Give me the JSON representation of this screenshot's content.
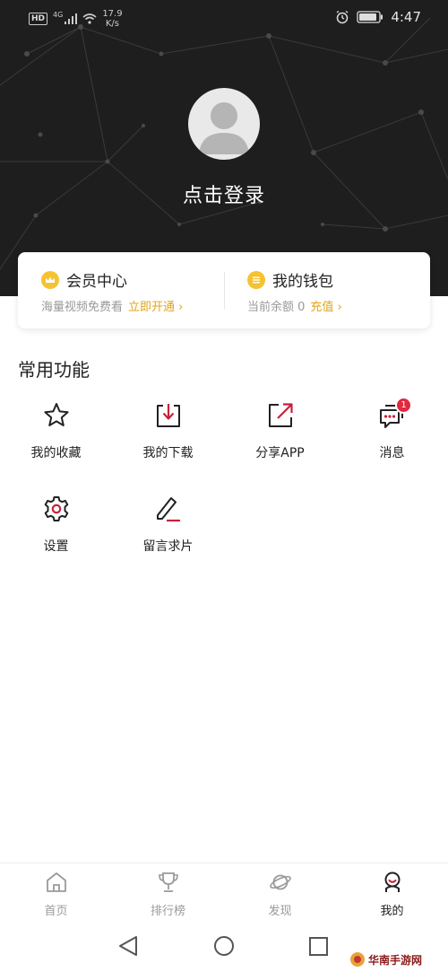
{
  "status_bar": {
    "hd": "HD",
    "signal_type": "4G",
    "net_speed_value": "17.9",
    "net_speed_unit": "K/s",
    "time": "4:47",
    "icons": [
      "signal-icon",
      "wifi-icon",
      "alarm-icon",
      "battery-icon"
    ]
  },
  "profile": {
    "login_text": "点击登录"
  },
  "membership": {
    "title": "会员中心",
    "subtitle": "海量视频免费看",
    "action": "立即开通 ›"
  },
  "wallet": {
    "title": "我的钱包",
    "subtitle": "当前余额 0",
    "action": "充值 ›"
  },
  "functions": {
    "section_title": "常用功能",
    "items": [
      {
        "label": "我的收藏",
        "icon": "star-icon"
      },
      {
        "label": "我的下载",
        "icon": "download-icon"
      },
      {
        "label": "分享APP",
        "icon": "share-icon"
      },
      {
        "label": "消息",
        "icon": "message-icon",
        "badge": "1"
      },
      {
        "label": "设置",
        "icon": "gear-icon"
      },
      {
        "label": "留言求片",
        "icon": "edit-icon"
      }
    ]
  },
  "bottom_nav": {
    "items": [
      {
        "label": "首页",
        "icon": "home-icon"
      },
      {
        "label": "排行榜",
        "icon": "trophy-icon"
      },
      {
        "label": "发现",
        "icon": "planet-icon"
      },
      {
        "label": "我的",
        "icon": "user-icon",
        "active": true
      }
    ]
  },
  "watermark": {
    "text": "华南手游网"
  },
  "colors": {
    "header_bg": "#1e1e1e",
    "accent_gold": "#f5c331",
    "link_gold": "#e2a418",
    "icon_red": "#c8213a",
    "badge_red": "#e0293f"
  }
}
